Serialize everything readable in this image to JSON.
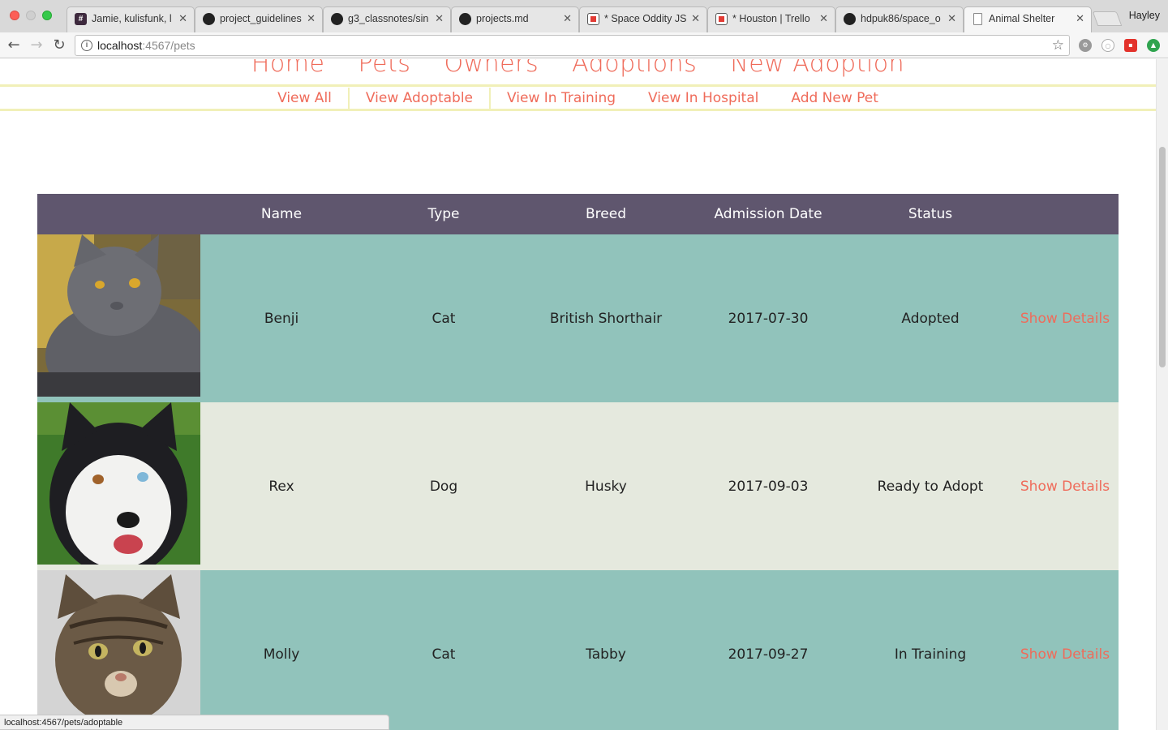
{
  "browser": {
    "tabs": [
      {
        "title": "Jamie, kulisfunk, l",
        "icon": "slack-icon"
      },
      {
        "title": "project_guidelines",
        "icon": "github-icon"
      },
      {
        "title": "g3_classnotes/sin",
        "icon": "github-icon"
      },
      {
        "title": "projects.md",
        "icon": "github-icon"
      },
      {
        "title": "* Space Oddity JS",
        "icon": "trello-icon"
      },
      {
        "title": "* Houston | Trello",
        "icon": "trello-icon"
      },
      {
        "title": "hdpuk86/space_o",
        "icon": "github-icon"
      },
      {
        "title": "Animal Shelter",
        "icon": "page-icon",
        "active": true
      }
    ],
    "profile_name": "Hayley",
    "url_host": "localhost",
    "url_path": ":4567/pets",
    "status_url": "localhost:4567/pets/adoptable"
  },
  "nav": {
    "main": [
      "Home",
      "Pets",
      "Owners",
      "Adoptions",
      "New Adoption"
    ],
    "sub": [
      "View All",
      "View Adoptable",
      "View In Training",
      "View In Hospital",
      "Add New Pet"
    ]
  },
  "table": {
    "headers": [
      "Name",
      "Type",
      "Breed",
      "Admission Date",
      "Status"
    ],
    "rows": [
      {
        "name": "Benji",
        "type": "Cat",
        "breed": "British Shorthair",
        "admission": "2017-07-30",
        "status": "Adopted",
        "action": "Show Details"
      },
      {
        "name": "Rex",
        "type": "Dog",
        "breed": "Husky",
        "admission": "2017-09-03",
        "status": "Ready to Adopt",
        "action": "Show Details"
      },
      {
        "name": "Molly",
        "type": "Cat",
        "breed": "Tabby",
        "admission": "2017-09-27",
        "status": "In Training",
        "action": "Show Details"
      }
    ]
  },
  "colors": {
    "accent": "#ef6b5a",
    "header_bg": "#5f566e",
    "row_teal": "#91c3bb",
    "row_pale": "#e5e9de",
    "nav_rule": "#f1f0b8"
  }
}
